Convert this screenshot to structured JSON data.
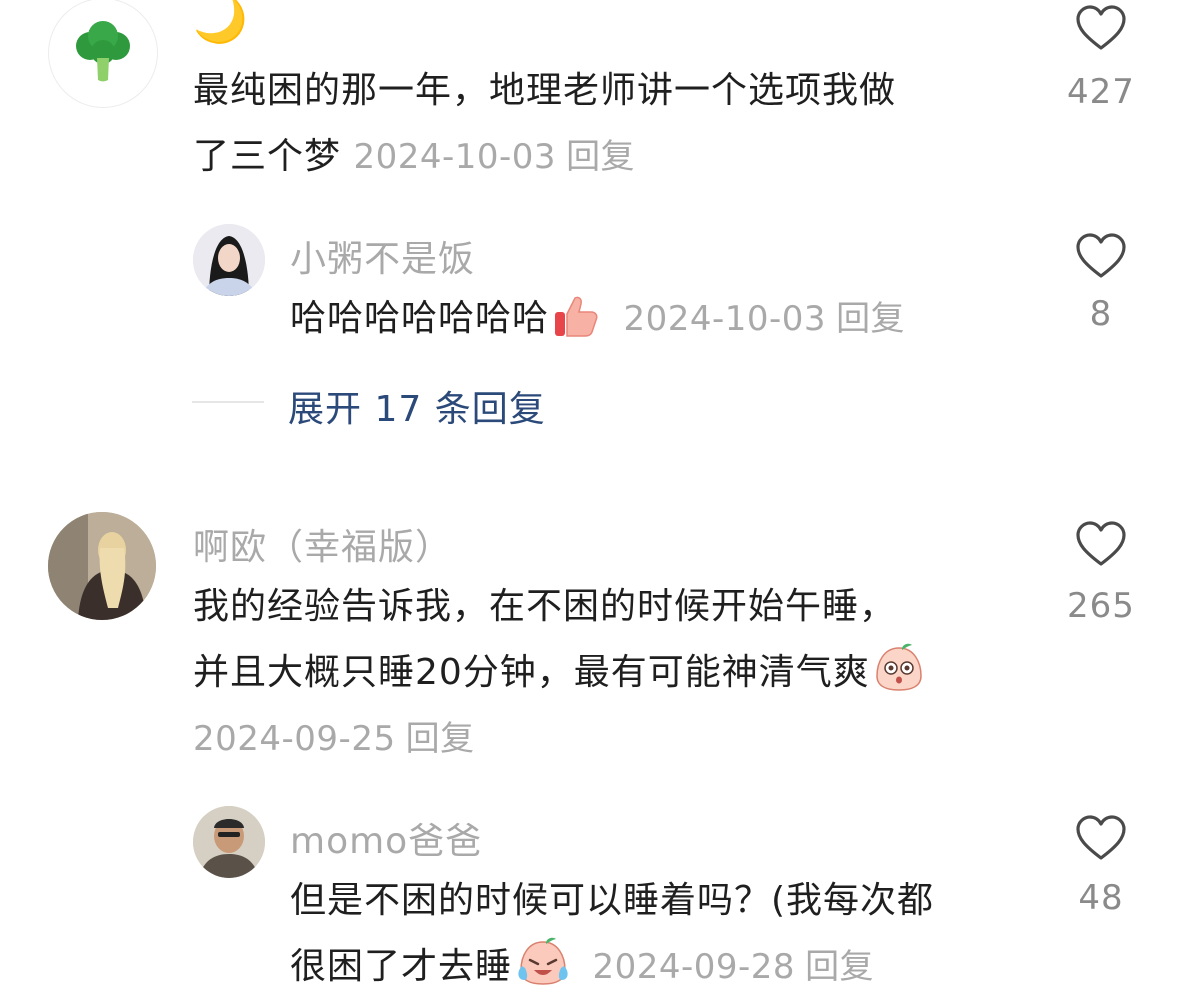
{
  "comments": [
    {
      "name": "🌙",
      "text_line1": "最纯困的那一年，地理老师讲一个选项我做",
      "text_line2": "了三个梦",
      "date": "2024-10-03",
      "reply_label": "回复",
      "likes": "427",
      "avatar_icon": "broccoli-icon"
    },
    {
      "name": "小粥不是饭",
      "text_line1": "哈哈哈哈哈哈哈",
      "date": "2024-10-03",
      "reply_label": "回复",
      "likes": "8",
      "emoji_icon": "thumbs-up-icon"
    },
    {
      "name": "啊欧（幸福版）",
      "text_line1": "我的经验告诉我，在不困的时候开始午睡，",
      "text_line2": "并且大概只睡20分钟，最有可能神清气爽",
      "date": "2024-09-25",
      "reply_label": "回复",
      "likes": "265",
      "emoji_icon": "surprised-face-icon"
    },
    {
      "name": "momo爸爸",
      "text_line1": "但是不困的时候可以睡着吗？(我每次都",
      "text_line2": "很困了才去睡",
      "date": "2024-09-28",
      "reply_label": "回复",
      "likes": "48",
      "emoji_icon": "crying-face-icon"
    }
  ],
  "expand_replies": "展开 17 条回复",
  "colors": {
    "primary_text": "#1f1f1f",
    "secondary_text": "#a9a9a9",
    "link": "#2b4a7a"
  }
}
